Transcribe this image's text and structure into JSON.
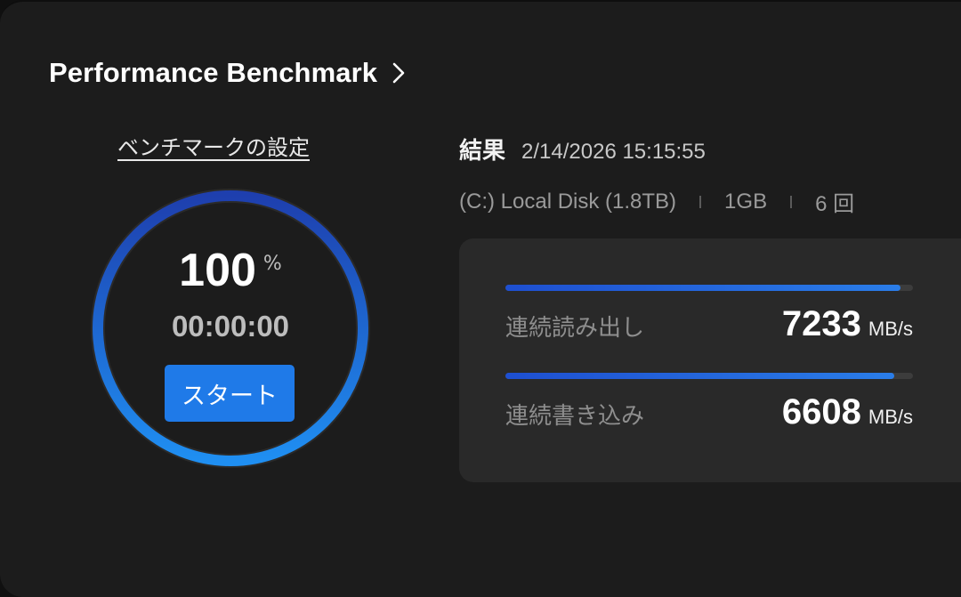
{
  "header": {
    "title": "Performance Benchmark",
    "chevron_icon": "chevron-right-icon"
  },
  "settings": {
    "link_label": "ベンチマークの設定"
  },
  "progress": {
    "percent": 100,
    "percent_text": "100",
    "unit": "%",
    "elapsed": "00:00:00",
    "start_label": "スタート",
    "ring_gradient": [
      "#1f8ff2",
      "#1e3fae"
    ]
  },
  "results": {
    "label": "結果",
    "timestamp": "2/14/2026 15:15:55",
    "drive": "(C:) Local Disk (1.8TB)",
    "size": "1GB",
    "count": "6 回",
    "metrics": [
      {
        "label": "連続読み出し",
        "value": "7233",
        "unit": "MB/s",
        "fill_fraction": 0.97
      },
      {
        "label": "連続書き込み",
        "value": "6608",
        "unit": "MB/s",
        "fill_fraction": 0.955
      }
    ]
  },
  "colors": {
    "accent": "#1f7ae8",
    "background": "#1c1c1c",
    "panel": "#292929"
  }
}
